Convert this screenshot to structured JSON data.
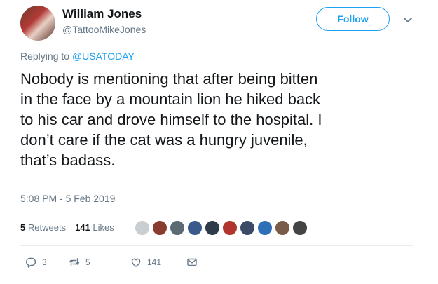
{
  "user": {
    "display_name": "William Jones",
    "handle": "@TattooMikeJones"
  },
  "follow_label": "Follow",
  "replying_to": {
    "prefix": "Replying to ",
    "mention": "@USATODAY"
  },
  "text": "Nobody is mentioning that after being bitten\nin the face by a mountain lion he hiked back\nto his car and drove himself to the hospital. I\ndon’t care if the cat was a hungry juvenile,\nthat’s badass.",
  "timestamp": "5:08 PM - 5 Feb 2019",
  "stats": {
    "retweets_count": "5",
    "retweets_label": "Retweets",
    "likes_count": "141",
    "likes_label": "Likes"
  },
  "liker_avatars": [
    "#c9ced3",
    "#8a3b2f",
    "#5c6a73",
    "#3a5a8c",
    "#2e3b4a",
    "#b0352f",
    "#3b4a66",
    "#2f6fb6",
    "#7a5a48",
    "#444444"
  ],
  "actions": {
    "reply_count": "3",
    "retweet_count": "5",
    "like_count": "141"
  },
  "colors": {
    "accent": "#1da1f2",
    "secondary_text": "#657786",
    "primary_text": "#14171a"
  },
  "icons": [
    "chevron-down-icon",
    "reply-icon",
    "retweet-icon",
    "heart-icon",
    "envelope-icon"
  ]
}
